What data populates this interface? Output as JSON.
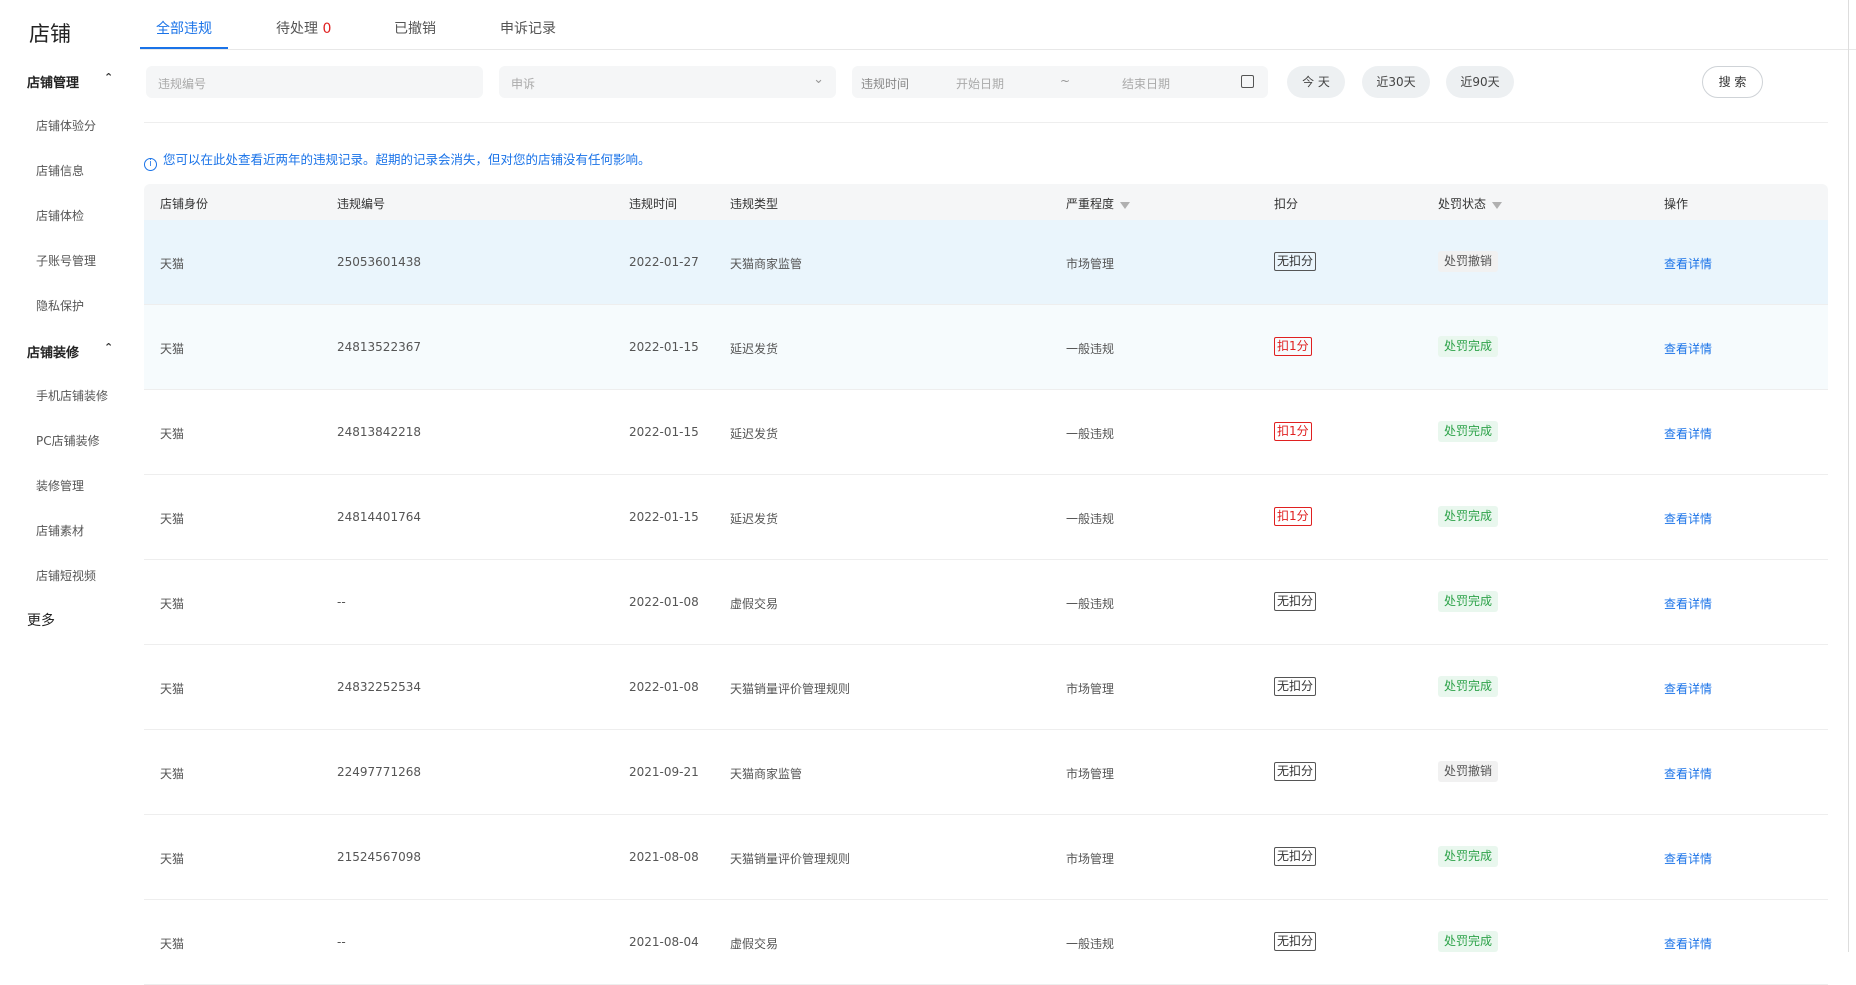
{
  "sidebar": {
    "title": "店铺",
    "groups": [
      {
        "label": "店铺管理",
        "items": [
          "店铺体验分",
          "店铺信息",
          "店铺体检",
          "子账号管理",
          "隐私保护"
        ]
      },
      {
        "label": "店铺装修",
        "items": [
          "手机店铺装修",
          "PC店铺装修",
          "装修管理",
          "店铺素材",
          "店铺短视频"
        ]
      }
    ],
    "more": "更多"
  },
  "tabs": [
    {
      "label": "全部违规"
    },
    {
      "label": "待处理",
      "count": "0"
    },
    {
      "label": "已撤销"
    },
    {
      "label": "申诉记录"
    }
  ],
  "filters": {
    "violation_no_placeholder": "违规编号",
    "type_select_value": "申诉",
    "time_label": "违规时间",
    "start_placeholder": "开始日期",
    "range_sep": "~",
    "end_placeholder": "结束日期",
    "chips": [
      "今 天",
      "近30天",
      "近90天"
    ],
    "search_label": "搜 索"
  },
  "notice": "您可以在此处查看近两年的违规记录。超期的记录会消失，但对您的店铺没有任何影响。",
  "table": {
    "headers": [
      "店铺身份",
      "违规编号",
      "违规时间",
      "违规类型",
      "严重程度",
      "扣分",
      "处罚状态",
      "操作"
    ],
    "rows": [
      {
        "identity": "天猫",
        "no": "25053601438",
        "date": "2022-01-27",
        "type": "天猫商家监管",
        "severity": "市场管理",
        "points": "无扣分",
        "status": "处罚撤销",
        "action": "查看详情"
      },
      {
        "identity": "天猫",
        "no": "24813522367",
        "date": "2022-01-15",
        "type": "延迟发货",
        "severity": "一般违规",
        "points": "扣1分",
        "status": "处罚完成",
        "action": "查看详情"
      },
      {
        "identity": "天猫",
        "no": "24813842218",
        "date": "2022-01-15",
        "type": "延迟发货",
        "severity": "一般违规",
        "points": "扣1分",
        "status": "处罚完成",
        "action": "查看详情"
      },
      {
        "identity": "天猫",
        "no": "24814401764",
        "date": "2022-01-15",
        "type": "延迟发货",
        "severity": "一般违规",
        "points": "扣1分",
        "status": "处罚完成",
        "action": "查看详情"
      },
      {
        "identity": "天猫",
        "no": "--",
        "date": "2022-01-08",
        "type": "虚假交易",
        "severity": "一般违规",
        "points": "无扣分",
        "status": "处罚完成",
        "action": "查看详情"
      },
      {
        "identity": "天猫",
        "no": "24832252534",
        "date": "2022-01-08",
        "type": "天猫销量评价管理规则",
        "severity": "市场管理",
        "points": "无扣分",
        "status": "处罚完成",
        "action": "查看详情"
      },
      {
        "identity": "天猫",
        "no": "22497771268",
        "date": "2021-09-21",
        "type": "天猫商家监管",
        "severity": "市场管理",
        "points": "无扣分",
        "status": "处罚撤销",
        "action": "查看详情"
      },
      {
        "identity": "天猫",
        "no": "21524567098",
        "date": "2021-08-08",
        "type": "天猫销量评价管理规则",
        "severity": "市场管理",
        "points": "无扣分",
        "status": "处罚完成",
        "action": "查看详情"
      },
      {
        "identity": "天猫",
        "no": "--",
        "date": "2021-08-04",
        "type": "虚假交易",
        "severity": "一般违规",
        "points": "无扣分",
        "status": "处罚完成",
        "action": "查看详情"
      }
    ]
  }
}
